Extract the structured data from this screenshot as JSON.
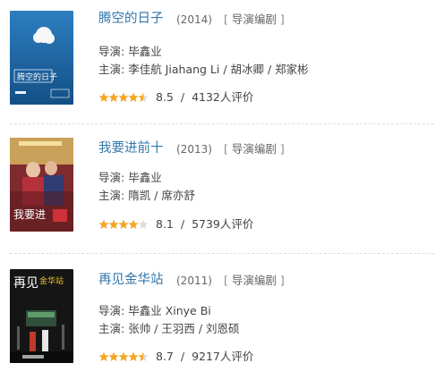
{
  "films": [
    {
      "title": "腾空的日子",
      "year": "(2014)",
      "tag": "导演编剧",
      "director_label": "导演:",
      "director": "毕鑫业",
      "cast_label": "主演:",
      "cast": "李佳航 Jiahang Li / 胡冰卿 / 郑家彬",
      "rating": "8.5",
      "rating_stars": 4.5,
      "separator": "/",
      "reviews": "4132人评价",
      "poster_text": "腾空的日子",
      "poster_bg": "#1f6aa8"
    },
    {
      "title": "我要进前十",
      "year": "(2013)",
      "tag": "导演编剧",
      "director_label": "导演:",
      "director": "毕鑫业",
      "cast_label": "主演:",
      "cast": "隋凯 / 席亦舒",
      "rating": "8.1",
      "rating_stars": 4,
      "separator": "/",
      "reviews": "5739人评价",
      "poster_text": "我要进",
      "poster_bg": "#8a2a2a"
    },
    {
      "title": "再见金华站",
      "year": "(2011)",
      "tag": "导演编剧",
      "director_label": "导演:",
      "director": "毕鑫业 Xinye Bi",
      "cast_label": "主演:",
      "cast": "张帅 / 王羽西 / 刘恩硕",
      "rating": "8.7",
      "rating_stars": 4.5,
      "separator": "/",
      "reviews": "9217人评价",
      "poster_text": "再见",
      "poster_text2": "金华站",
      "poster_bg": "#151515"
    }
  ],
  "colors": {
    "title": "#3377aa",
    "star": "#f5a623",
    "star_empty": "#dddddd"
  }
}
